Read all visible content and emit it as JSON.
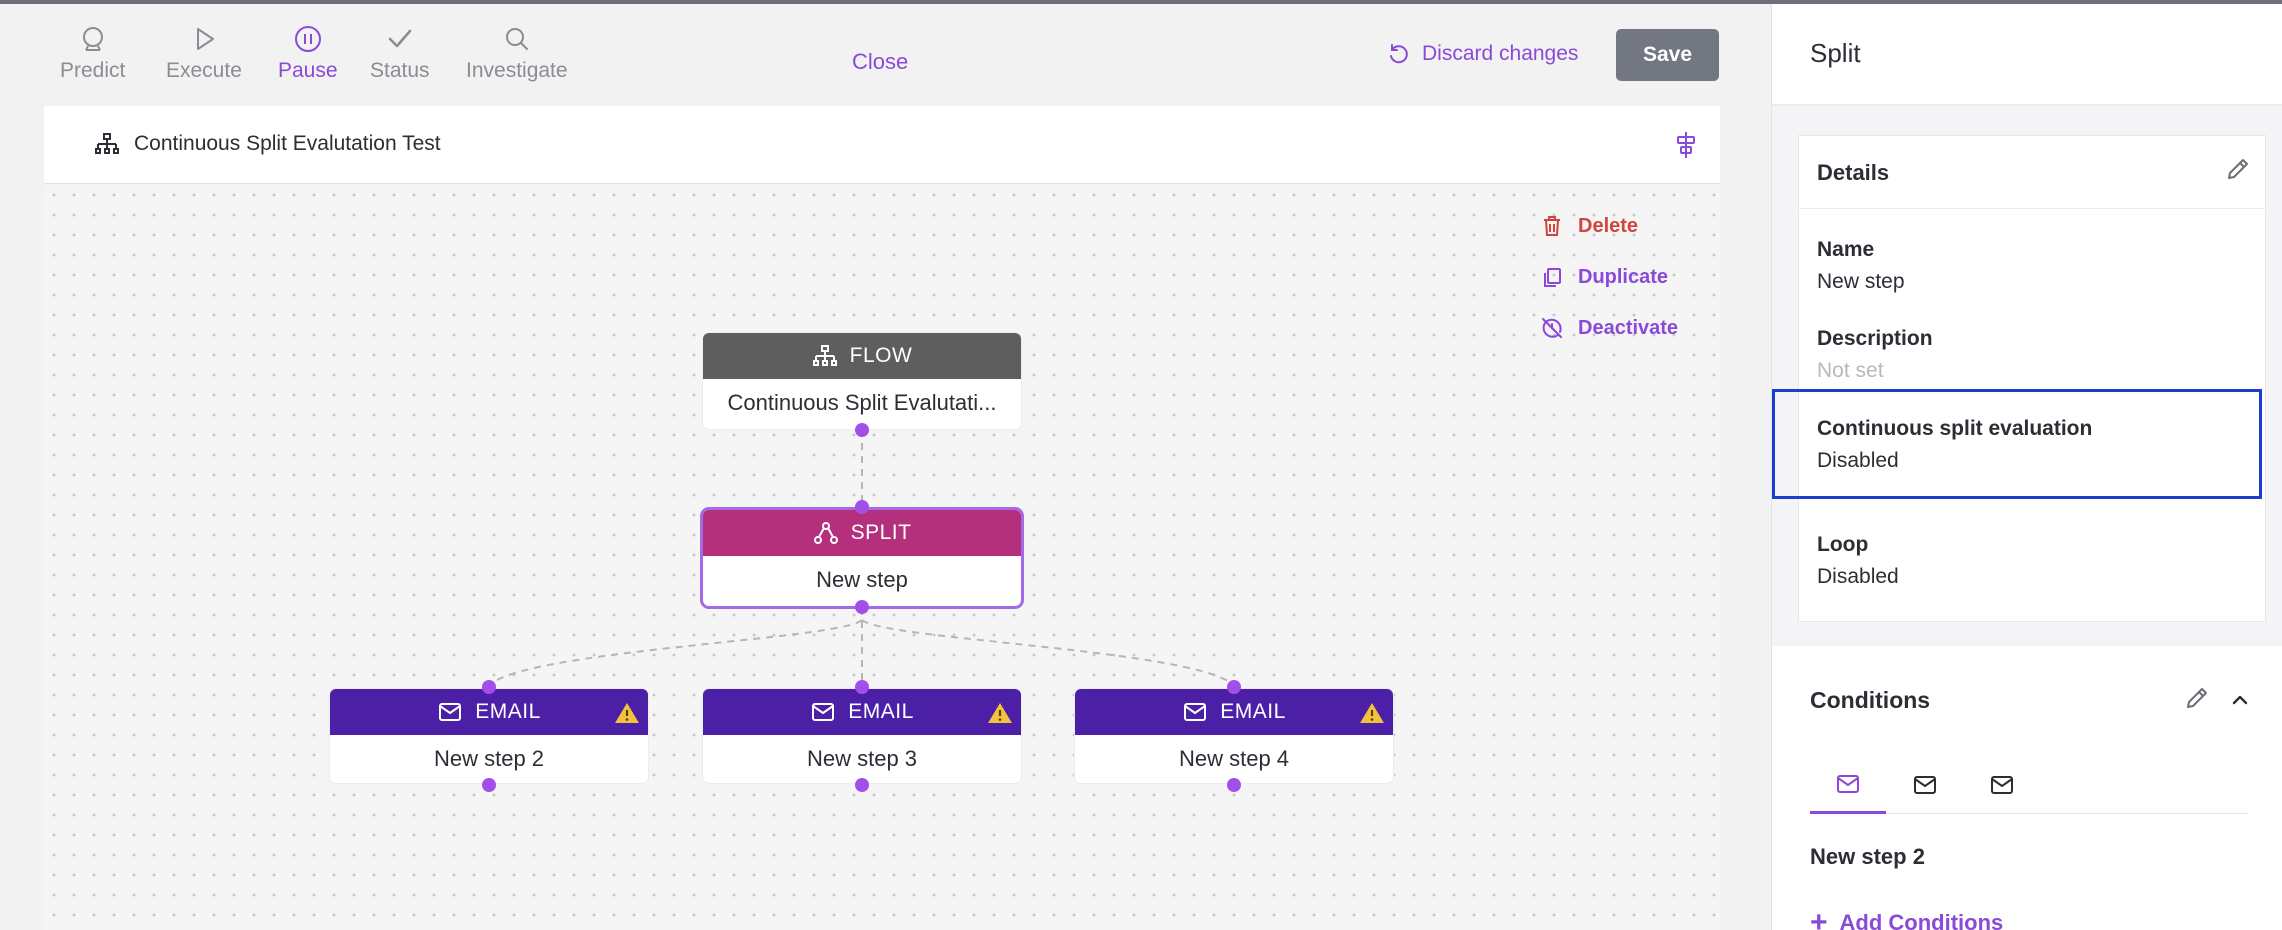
{
  "toolbar": {
    "tools": [
      {
        "label": "Predict",
        "icon": "predict-icon",
        "active": false
      },
      {
        "label": "Execute",
        "icon": "play-icon",
        "active": false
      },
      {
        "label": "Pause",
        "icon": "pause-icon",
        "active": true
      },
      {
        "label": "Status",
        "icon": "check-icon",
        "active": false
      },
      {
        "label": "Investigate",
        "icon": "search-icon",
        "active": false
      }
    ],
    "close_label": "Close",
    "discard_label": "Discard changes",
    "save_label": "Save"
  },
  "canvas": {
    "title": "Continuous Split Evalutation Test",
    "actions": {
      "delete": "Delete",
      "duplicate": "Duplicate",
      "deactivate": "Deactivate"
    },
    "nodes": {
      "flow": {
        "type": "FLOW",
        "name": "Continuous Split Evalutati..."
      },
      "split": {
        "type": "SPLIT",
        "name": "New step"
      },
      "email1": {
        "type": "EMAIL",
        "name": "New step 2"
      },
      "email2": {
        "type": "EMAIL",
        "name": "New step 3"
      },
      "email3": {
        "type": "EMAIL",
        "name": "New step 4"
      }
    }
  },
  "panel": {
    "title": "Split",
    "details": {
      "header": "Details",
      "name_label": "Name",
      "name_value": "New step",
      "description_label": "Description",
      "description_value": "Not set",
      "continuous_label": "Continuous split evaluation",
      "continuous_value": "Disabled",
      "loop_label": "Loop",
      "loop_value": "Disabled"
    },
    "conditions": {
      "title": "Conditions",
      "tabs": [
        "mail-icon",
        "mail-icon",
        "mail-icon"
      ],
      "selected_step": "New step 2",
      "add_label": "Add Conditions"
    }
  },
  "colors": {
    "accent": "#8a4ad8",
    "flow_header": "#5e5e5e",
    "split_header": "#b5307c",
    "email_header": "#4b1fa6",
    "delete": "#d0453c",
    "highlight": "#1a3ecf"
  }
}
